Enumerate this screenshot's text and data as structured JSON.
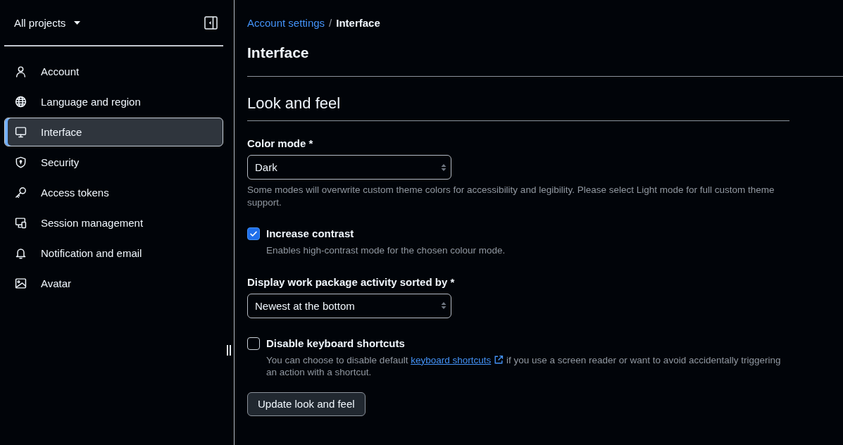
{
  "sidebar": {
    "project_selector": "All projects",
    "items": [
      {
        "label": "Account",
        "selected": false
      },
      {
        "label": "Language and region",
        "selected": false
      },
      {
        "label": "Interface",
        "selected": true
      },
      {
        "label": "Security",
        "selected": false
      },
      {
        "label": "Access tokens",
        "selected": false
      },
      {
        "label": "Session management",
        "selected": false
      },
      {
        "label": "Notification and email",
        "selected": false
      },
      {
        "label": "Avatar",
        "selected": false
      }
    ]
  },
  "breadcrumb": {
    "separator": "/",
    "items": [
      {
        "label": "Account settings",
        "kind": "link"
      },
      {
        "label": "Interface",
        "kind": "current"
      }
    ]
  },
  "page_title": "Interface",
  "section": {
    "title": "Look and feel",
    "fields": [
      {
        "kind": "select",
        "label": "Color mode *",
        "value": "Dark",
        "caption": [
          {
            "kind": "text",
            "text": "Some modes will overwrite custom theme colors for accessibility and legibility. Please select Light mode for full custom theme support."
          }
        ]
      },
      {
        "kind": "checkbox",
        "label": "Increase contrast",
        "checked": true,
        "caption": [
          {
            "kind": "text",
            "text": "Enables high-contrast mode for the chosen colour mode."
          }
        ]
      },
      {
        "kind": "select",
        "label": "Display work package activity sorted by *",
        "value": "Newest at the bottom"
      },
      {
        "kind": "checkbox",
        "label": "Disable keyboard shortcuts",
        "checked": false,
        "caption": [
          {
            "kind": "text",
            "text": "You can choose to disable default"
          },
          {
            "kind": "link",
            "text": "keyboard shortcuts"
          },
          {
            "kind": "text",
            "text": "if you use a screen reader or want to avoid accidentally triggering an action with a shortcut."
          }
        ]
      }
    ],
    "submit_button": "Update look and feel"
  }
}
